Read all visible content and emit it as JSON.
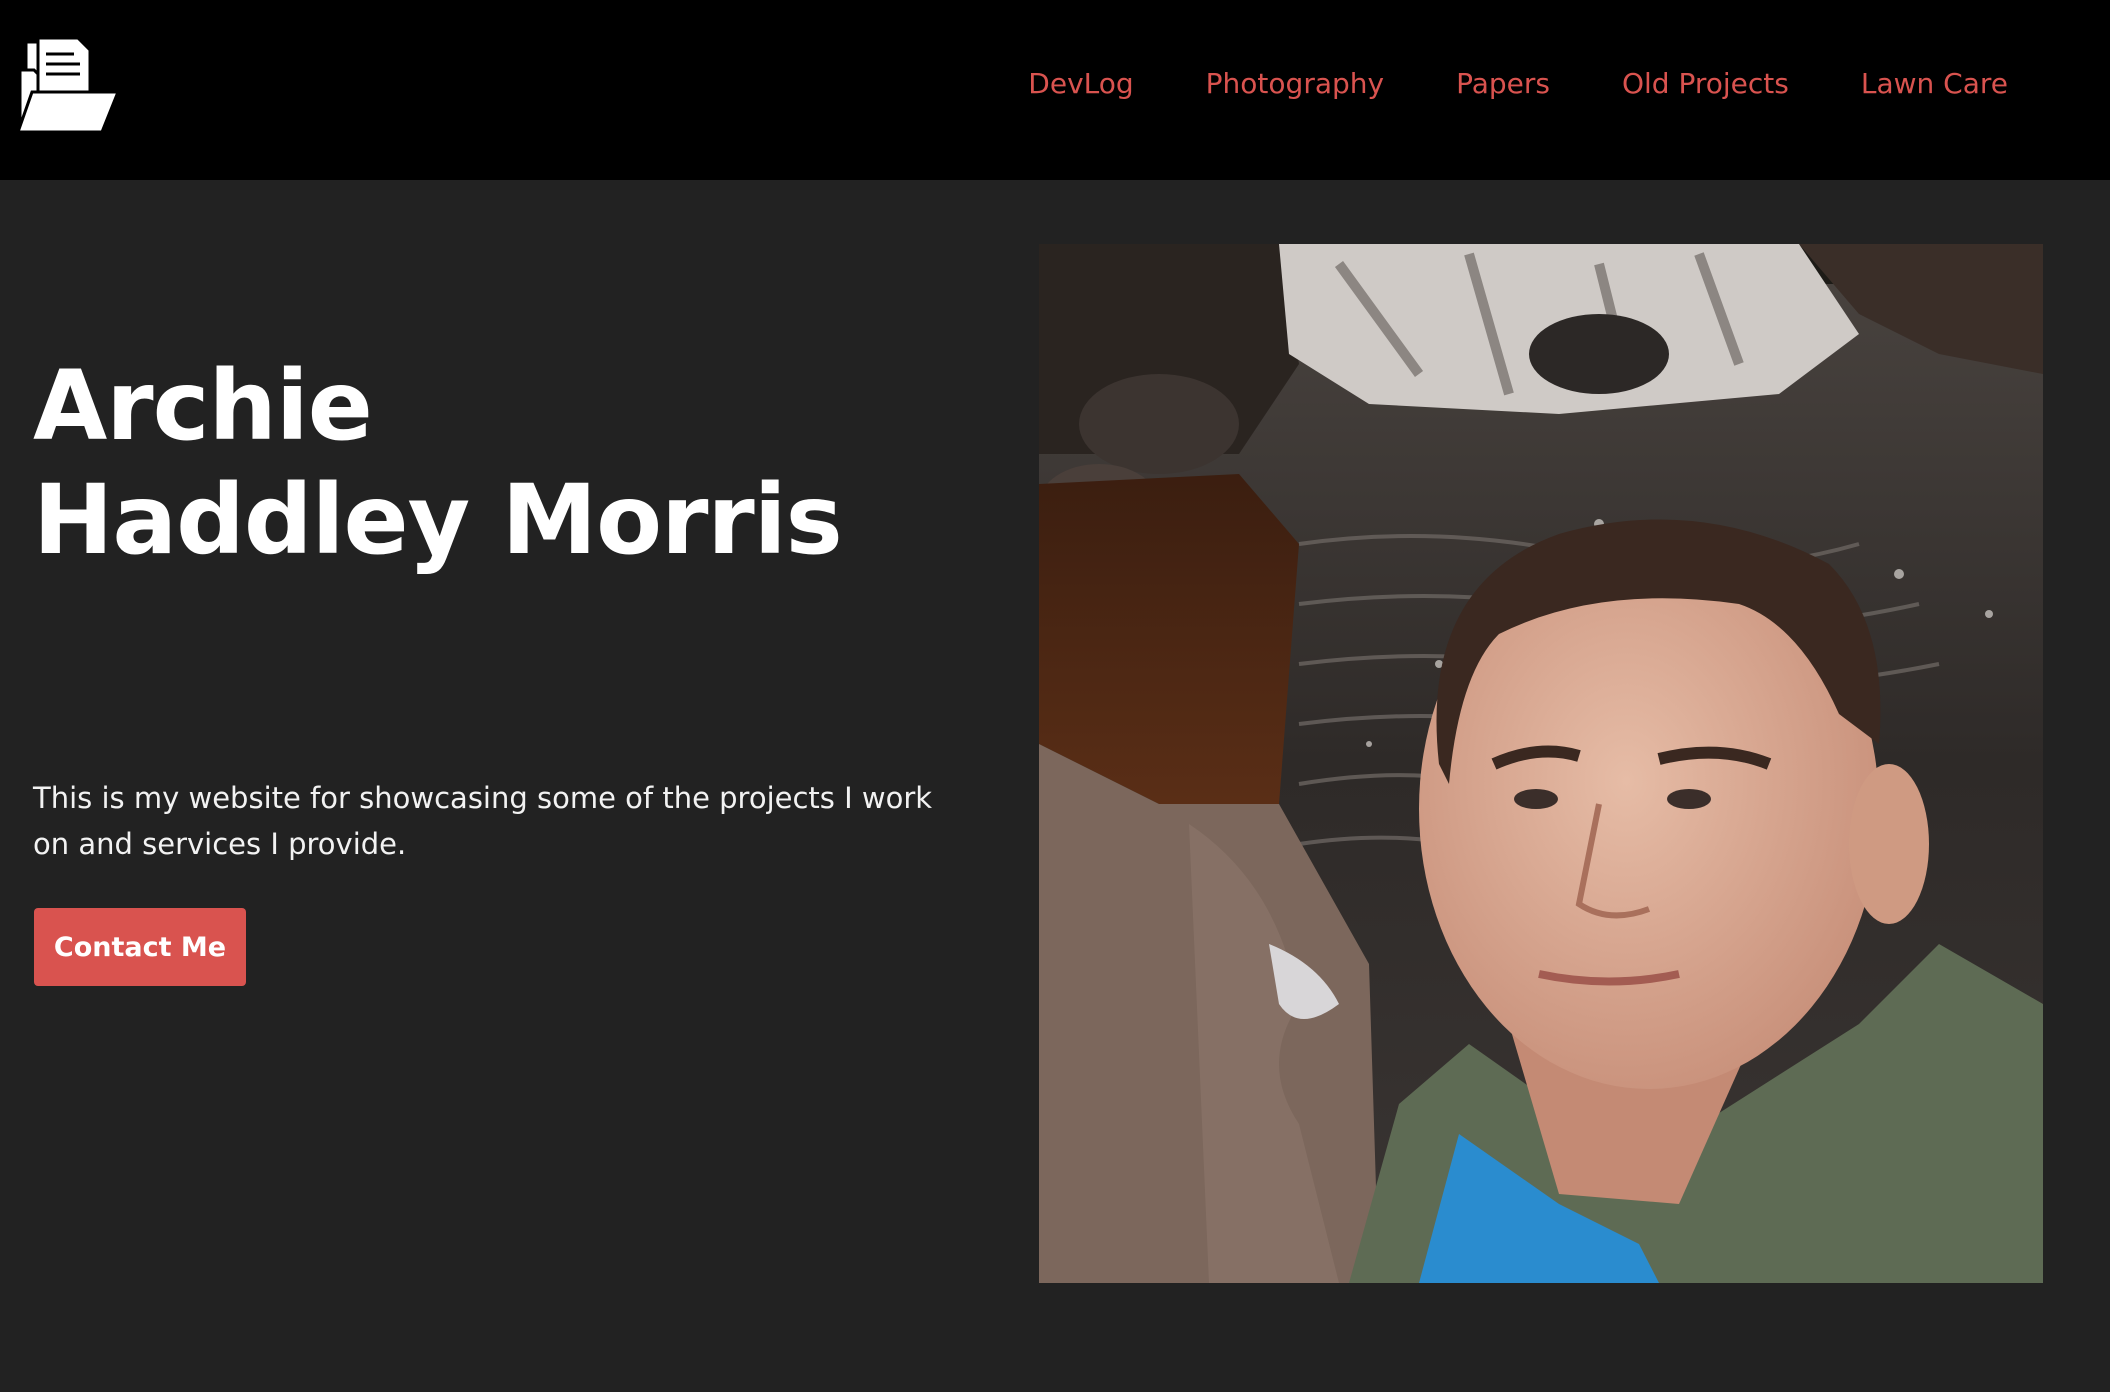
{
  "header": {
    "logo_icon": "folder-document-icon",
    "nav": [
      {
        "label": "DevLog"
      },
      {
        "label": "Photography"
      },
      {
        "label": "Papers"
      },
      {
        "label": "Old Projects"
      },
      {
        "label": "Lawn Care"
      }
    ]
  },
  "hero": {
    "title_line1": "Archie",
    "title_line2": "Haddley Morris",
    "subtitle": "This is my website for showcasing some of the projects I work on and services I provide.",
    "contact_label": "Contact Me"
  },
  "colors": {
    "accent": "#d9534f",
    "header_bg": "#000000",
    "page_bg": "#222222",
    "text": "#ffffff"
  },
  "photo": {
    "subject": "selfie-by-waterfall-photo"
  }
}
